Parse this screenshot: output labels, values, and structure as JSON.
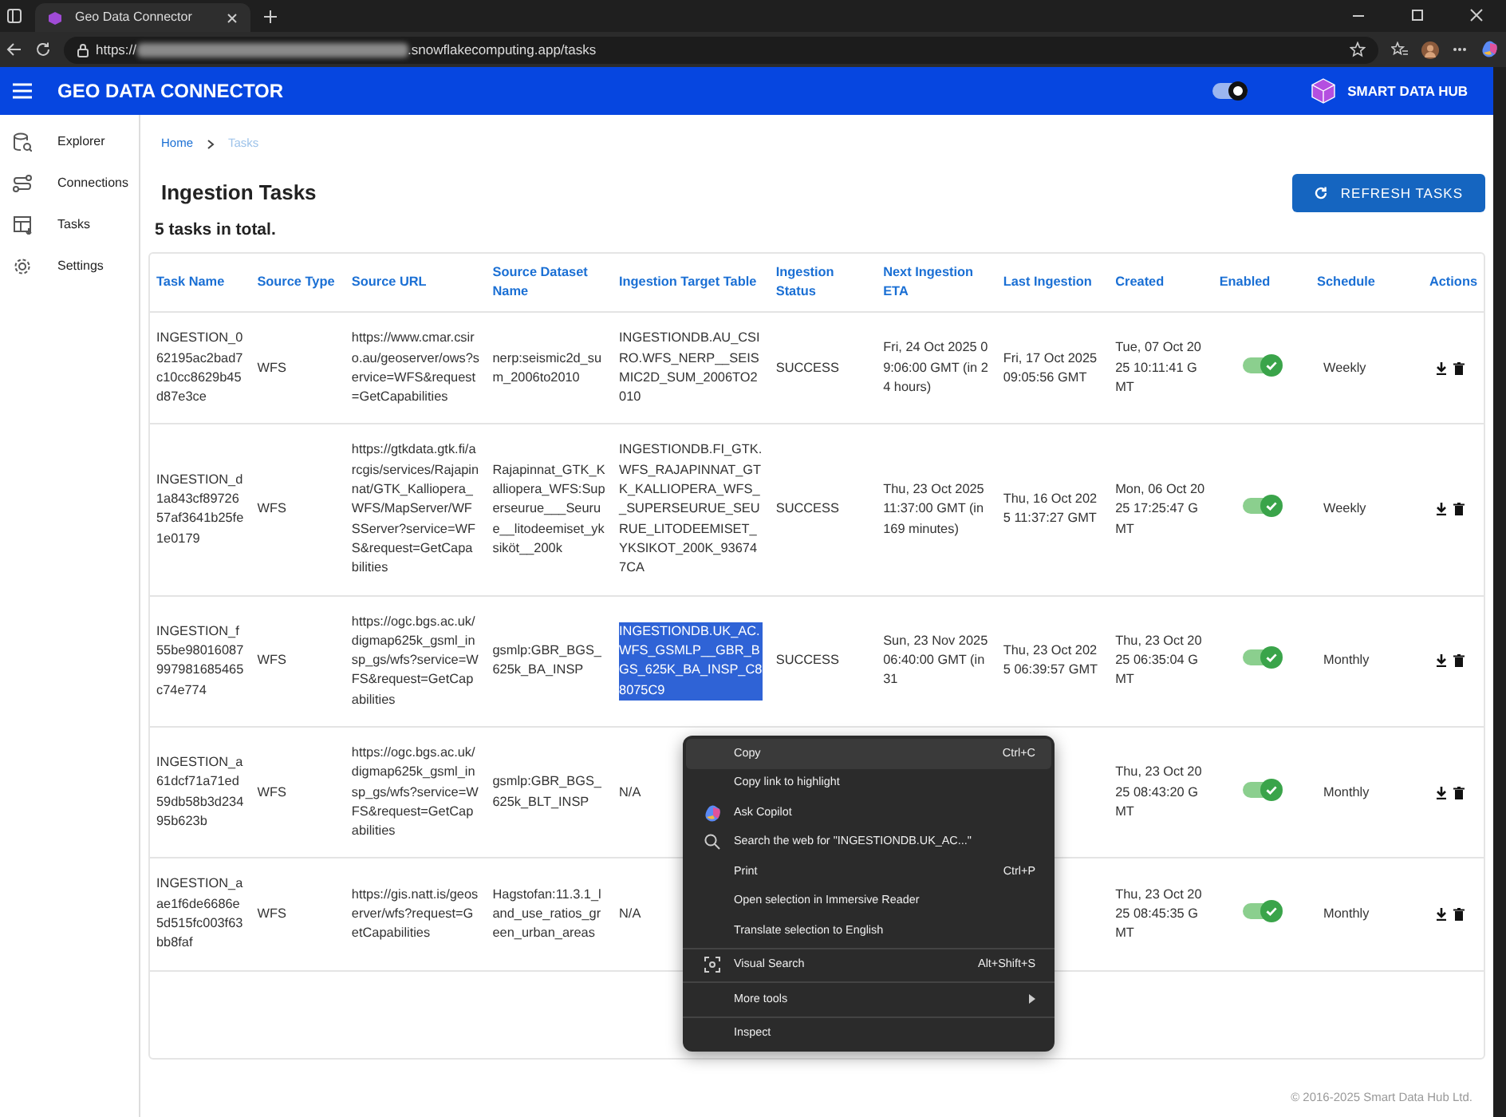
{
  "browser": {
    "tab_title": "Geo Data Connector",
    "url_prefix": "https://",
    "url_suffix": ".snowflakecomputing.app/tasks"
  },
  "app_bar": {
    "title": "GEO DATA CONNECTOR",
    "theme_toggle_on": true,
    "brand": "SMART DATA HUB"
  },
  "sidebar": {
    "items": [
      {
        "label": "Explorer",
        "kind": "explorer",
        "selected": false
      },
      {
        "label": "Connections",
        "kind": "connections",
        "selected": false
      },
      {
        "label": "Tasks",
        "kind": "tasks",
        "selected": false
      },
      {
        "label": "Settings",
        "kind": "settings",
        "selected": false
      }
    ]
  },
  "breadcrumb": [
    "Home",
    "Tasks"
  ],
  "page_title": "Ingestion Tasks",
  "refresh_button": "REFRESH TASKS",
  "total": "5 tasks in total.",
  "table": {
    "columns": [
      "Task Name",
      "Source Type",
      "Source URL",
      "Source Dataset Name",
      "Ingestion Target Table",
      "Ingestion Status",
      "Next Ingestion ETA",
      "Last Ingestion",
      "Created",
      "Enabled",
      "Schedule",
      "Actions"
    ],
    "rows": [
      {
        "task": "INGESTION_062195ac2bad7c10cc8629b45d87e3ce",
        "type": "WFS",
        "url": "https://www.cmar.csiro.au/geoserver/ows?service=WFS&request=GetCapabilities",
        "dataset": "nerp:seismic2d_sum_2006to2010",
        "target": "INGESTIONDB.AU_CSIRO.WFS_NERP__SEISMIC2D_SUM_2006TO2010",
        "target_selected": false,
        "status": "SUCCESS",
        "next": "Fri, 24 Oct 2025 09:06:00 GMT (in 24 hours)",
        "last": "Fri, 17 Oct 2025 09:05:56 GMT",
        "created": "Tue, 07 Oct 2025 10:11:41 GMT",
        "enabled": true,
        "schedule": "Weekly"
      },
      {
        "task": "INGESTION_d1a843cf8972657af3641b25fe1e0179",
        "type": "WFS",
        "url": "https://gtkdata.gtk.fi/arcgis/services/Rajapinnat/GTK_Kalliopera_WFS/MapServer/WFSServer?service=WFS&request=GetCapabilities",
        "dataset": "Rajapinnat_GTK_Kalliopera_WFS:Superseurue___Seurue__litodeemiset_yksiköt__200k",
        "target": "INGESTIONDB.FI_GTK.WFS_RAJAPINNAT_GTK_KALLIOPERA_WFS__SUPERSEURUE_SEURUE_LITODEEMISET_YKSIKOT_200K_936747CA",
        "target_selected": false,
        "status": "SUCCESS",
        "next": "Thu, 23 Oct 2025 11:37:00 GMT (in 169 minutes)",
        "last": "Thu, 16 Oct 2025 11:37:27 GMT",
        "created": "Mon, 06 Oct 2025 17:25:47 GMT",
        "enabled": true,
        "schedule": "Weekly"
      },
      {
        "task": "INGESTION_f55be98016087997981685465c74e774",
        "type": "WFS",
        "url": "https://ogc.bgs.ac.uk/digmap625k_gsml_insp_gs/wfs?service=WFS&request=GetCapabilities",
        "dataset": "gsmlp:GBR_BGS_625k_BA_INSP",
        "target": "INGESTIONDB.UK_AC.WFS_GSMLP__GBR_BGS_625K_BA_INSP_C88075C9",
        "target_selected": true,
        "status": "SUCCESS",
        "next": "Sun, 23 Nov 2025 06:40:00 GMT (in 31",
        "last": "Thu, 23 Oct 2025 06:39:57 GMT",
        "created": "Thu, 23 Oct 2025 06:35:04 GMT",
        "enabled": true,
        "schedule": "Monthly"
      },
      {
        "task": "INGESTION_a61dcf71a71ed59db58b3d23495b623b",
        "type": "WFS",
        "url": "https://ogc.bgs.ac.uk/digmap625k_gsml_insp_gs/wfs?service=WFS&request=GetCapabilities",
        "dataset": "gsmlp:GBR_BGS_625k_BLT_INSP",
        "target": "N/A",
        "target_selected": false,
        "created": "Thu, 23 Oct 2025 08:43:20 GMT",
        "enabled": true,
        "schedule": "Monthly"
      },
      {
        "task": "INGESTION_aae1f6de6686e5d515fc003f63bb8faf",
        "type": "WFS",
        "url": "https://gis.natt.is/geoserver/wfs?request=GetCapabilities",
        "dataset": "Hagstofan:11.3.1_land_use_ratios_green_urban_areas",
        "target": "N/A",
        "target_selected": false,
        "created": "Thu, 23 Oct 2025 08:45:35 GMT",
        "enabled": true,
        "schedule": "Monthly"
      }
    ]
  },
  "context_menu": {
    "items": [
      {
        "label": "Copy",
        "shortcut": "Ctrl+C",
        "kind": "plain",
        "hovered": true,
        "separator_before": false
      },
      {
        "label": "Copy link to highlight",
        "kind": "plain",
        "hovered": false,
        "separator_before": false
      },
      {
        "label": "Ask Copilot",
        "kind": "copilot",
        "hovered": false,
        "separator_before": false
      },
      {
        "label": "Search the web for \"INGESTIONDB.UK_AC...\"",
        "kind": "search",
        "hovered": false,
        "separator_before": false
      },
      {
        "label": "Print",
        "shortcut": "Ctrl+P",
        "kind": "plain",
        "hovered": false,
        "separator_before": false
      },
      {
        "label": "Open selection in Immersive Reader",
        "kind": "plain",
        "hovered": false,
        "separator_before": false
      },
      {
        "label": "Translate selection to English",
        "kind": "plain",
        "hovered": false,
        "separator_before": false
      },
      {
        "label": "Visual Search",
        "shortcut": "Alt+Shift+S",
        "kind": "lens",
        "hovered": false,
        "separator_before": true
      },
      {
        "label": "More tools",
        "kind": "submenu",
        "hovered": false,
        "separator_before": true
      },
      {
        "label": "Inspect",
        "kind": "plain",
        "hovered": false,
        "separator_before": true
      }
    ]
  },
  "footer": "© 2016-2025 Smart Data Hub Ltd."
}
